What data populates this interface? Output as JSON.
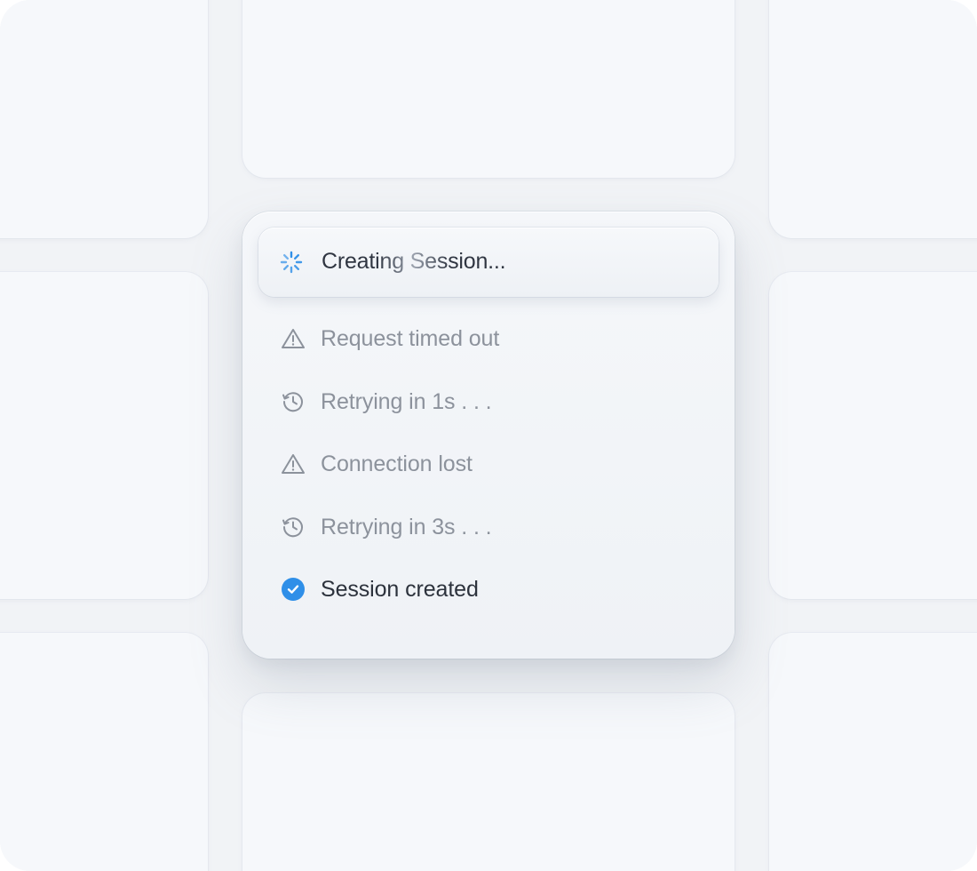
{
  "card": {
    "title": "Creating Session...",
    "events": [
      {
        "icon": "warning-icon",
        "label": "Request timed out",
        "status": "warning"
      },
      {
        "icon": "history-icon",
        "label": "Retrying in 1s . . .",
        "status": "retry"
      },
      {
        "icon": "warning-icon",
        "label": "Connection lost",
        "status": "warning"
      },
      {
        "icon": "history-icon",
        "label": "Retrying in 3s . . .",
        "status": "retry"
      },
      {
        "icon": "check-circle-icon",
        "label": "Session created",
        "status": "success"
      }
    ]
  },
  "colors": {
    "accent": "#2f8fe8",
    "muted_text": "#8c929c",
    "strong_text": "#2c323c",
    "background": "#f1f3f6"
  }
}
